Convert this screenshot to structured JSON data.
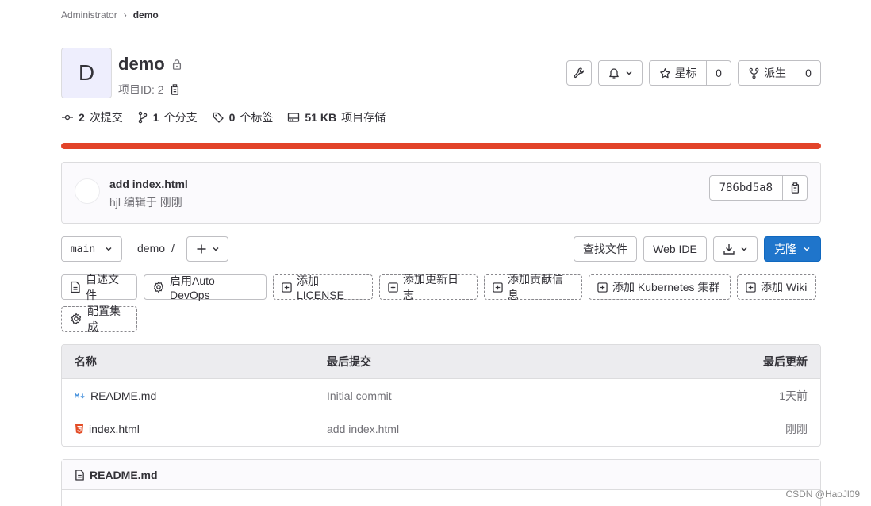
{
  "breadcrumb": {
    "parent": "Administrator",
    "separator": "›",
    "current": "demo"
  },
  "project": {
    "avatar_letter": "D",
    "name": "demo",
    "id_label": "项目ID: 2"
  },
  "header_actions": {
    "star_label": "星标",
    "star_count": "0",
    "fork_label": "派生",
    "fork_count": "0"
  },
  "stats": [
    {
      "count": "2",
      "label": "次提交"
    },
    {
      "count": "1",
      "label": "个分支"
    },
    {
      "count": "0",
      "label": "个标签"
    },
    {
      "count": "51 KB",
      "label": "项目存储"
    }
  ],
  "pipeline": {
    "status_color": "#e24329"
  },
  "last_commit": {
    "message": "add index.html",
    "meta": "hjl 编辑于 刚刚",
    "sha": "786bd5a8"
  },
  "toolbar": {
    "branch": "main",
    "path": "demo",
    "path_sep": "/",
    "find_file": "查找文件",
    "web_ide": "Web IDE",
    "clone": "克隆"
  },
  "quick_actions": {
    "readme": "自述文件",
    "autodevops": "启用Auto DevOps",
    "license": "添加LICENSE",
    "changelog": "添加更新日志",
    "contributing": "添加贡献信息",
    "kubernetes": "添加 Kubernetes 集群",
    "wiki": "添加 Wiki",
    "integrations": "配置集成"
  },
  "file_table": {
    "headers": {
      "name": "名称",
      "commit": "最后提交",
      "updated": "最后更新"
    },
    "rows": [
      {
        "name": "README.md",
        "commit": "Initial commit",
        "updated": "1天前",
        "icon": "markdown-icon"
      },
      {
        "name": "index.html",
        "commit": "add index.html",
        "updated": "刚刚",
        "icon": "html5-icon"
      }
    ]
  },
  "readme": {
    "title": "README.md"
  },
  "watermark": "CSDN @HaoJl09",
  "colors": {
    "primary": "#1f75cb",
    "pipeline_failed": "#e24329",
    "markdown_icon": "#428fdc",
    "html_icon": "#e34c26"
  }
}
